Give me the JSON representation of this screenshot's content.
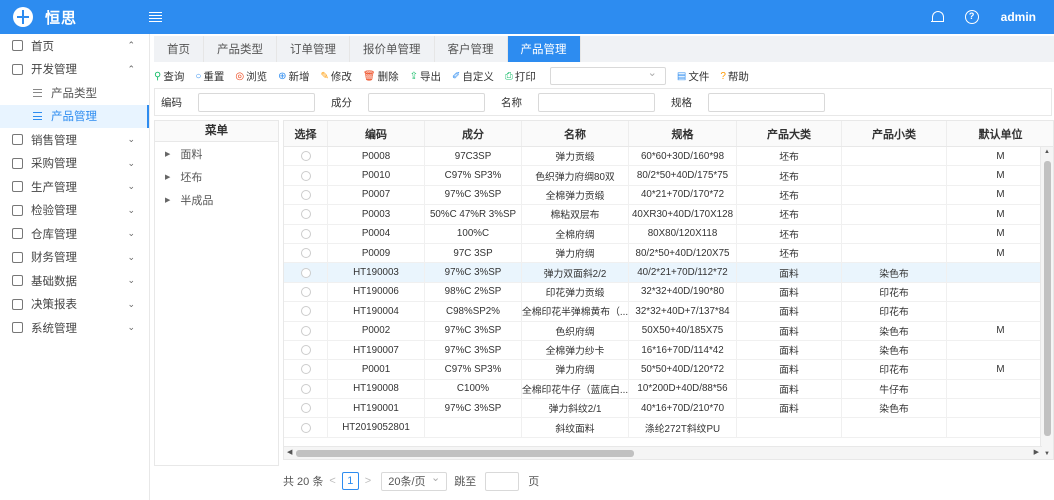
{
  "header": {
    "brand": "恒思",
    "username": "admin",
    "bg_color": "#2d8cf0"
  },
  "sidebar": {
    "items": [
      {
        "label": "首页",
        "icon": "home-icon",
        "arrow": "⌃"
      },
      {
        "label": "开发管理",
        "icon": "dev-icon",
        "arrow": "⌃",
        "children": [
          {
            "label": "产品类型",
            "active": false
          },
          {
            "label": "产品管理",
            "active": true
          }
        ]
      },
      {
        "label": "销售管理",
        "icon": "sales-icon",
        "arrow": "⌄"
      },
      {
        "label": "采购管理",
        "icon": "cart-icon",
        "arrow": "⌄"
      },
      {
        "label": "生产管理",
        "icon": "production-icon",
        "arrow": "⌄"
      },
      {
        "label": "检验管理",
        "icon": "inspection-icon",
        "arrow": "⌄"
      },
      {
        "label": "仓库管理",
        "icon": "warehouse-icon",
        "arrow": "⌄"
      },
      {
        "label": "财务管理",
        "icon": "finance-icon",
        "arrow": "⌄"
      },
      {
        "label": "基础数据",
        "icon": "chart-icon",
        "arrow": "⌄"
      },
      {
        "label": "决策报表",
        "icon": "report-icon",
        "arrow": "⌄"
      },
      {
        "label": "系统管理",
        "icon": "gear-icon",
        "arrow": "⌄"
      }
    ]
  },
  "tabs": [
    {
      "label": "首页",
      "active": false
    },
    {
      "label": "产品类型",
      "active": false
    },
    {
      "label": "订单管理",
      "active": false
    },
    {
      "label": "报价单管理",
      "active": false
    },
    {
      "label": "客户管理",
      "active": false
    },
    {
      "label": "产品管理",
      "active": true
    }
  ],
  "toolbar": {
    "buttons": [
      {
        "label": "查询",
        "icon": "search-icon",
        "glyph": "⚲",
        "color": "#19be6b"
      },
      {
        "label": "重置",
        "icon": "reset-icon",
        "glyph": "○",
        "color": "#2d8cf0"
      },
      {
        "label": "浏览",
        "icon": "eye-icon",
        "glyph": "◎",
        "color": "#ed4014"
      },
      {
        "label": "新增",
        "icon": "add-icon",
        "glyph": "⊕",
        "color": "#2d8cf0"
      },
      {
        "label": "修改",
        "icon": "edit-icon",
        "glyph": "✎",
        "color": "#ff9900"
      },
      {
        "label": "删除",
        "icon": "trash-icon",
        "glyph": "🗑",
        "color": "#ed4014"
      },
      {
        "label": "导出",
        "icon": "export-icon",
        "glyph": "⇪",
        "color": "#19be6b"
      },
      {
        "label": "自定义",
        "icon": "custom-icon",
        "glyph": "✐",
        "color": "#2d8cf0"
      },
      {
        "label": "打印",
        "icon": "print-icon",
        "glyph": "⎙",
        "color": "#19be6b"
      }
    ],
    "after_select": [
      {
        "label": "文件",
        "icon": "file-icon",
        "glyph": "▤",
        "color": "#2d8cf0"
      },
      {
        "label": "帮助",
        "icon": "help-icon",
        "glyph": "?",
        "color": "#ff9900"
      }
    ]
  },
  "search": {
    "fields": [
      {
        "label": "编码",
        "value": ""
      },
      {
        "label": "成分",
        "value": ""
      },
      {
        "label": "名称",
        "value": ""
      },
      {
        "label": "规格",
        "value": ""
      }
    ]
  },
  "tree": {
    "title": "菜单",
    "nodes": [
      "面料",
      "坯布",
      "半成品"
    ]
  },
  "grid": {
    "columns": [
      "选择",
      "编码",
      "成分",
      "名称",
      "规格",
      "产品大类",
      "产品小类",
      "默认单位"
    ],
    "rows": [
      [
        "P0008",
        "97C3SP",
        "弹力贡缎",
        "60*60+30D/160*98",
        "坯布",
        "",
        "M"
      ],
      [
        "P0010",
        "C97% SP3%",
        "色织弹力府绸80双",
        "80/2*50+40D/175*75",
        "坯布",
        "",
        "M"
      ],
      [
        "P0007",
        "97%C 3%SP",
        "全棉弹力贡缎",
        "40*21+70D/170*72",
        "坯布",
        "",
        "M"
      ],
      [
        "P0003",
        "50%C 47%R 3%SP",
        "棉粘双层布",
        "40XR30+40D/170X128",
        "坯布",
        "",
        "M"
      ],
      [
        "P0004",
        "100%C",
        "全棉府绸",
        "80X80/120X118",
        "坯布",
        "",
        "M"
      ],
      [
        "P0009",
        "97C 3SP",
        "弹力府绸",
        "80/2*50+40D/120X75",
        "坯布",
        "",
        "M"
      ],
      [
        "HT190003",
        "97%C 3%SP",
        "弹力双面斜2/2",
        "40/2*21+70D/112*72",
        "面料",
        "染色布",
        ""
      ],
      [
        "HT190006",
        "98%C 2%SP",
        "印花弹力贡缎",
        "32*32+40D/190*80",
        "面料",
        "印花布",
        ""
      ],
      [
        "HT190004",
        "C98%SP2%",
        "全棉印花半弹棉黄布（...",
        "32*32+40D+7/137*84",
        "面料",
        "印花布",
        ""
      ],
      [
        "P0002",
        "97%C 3%SP",
        "色织府绸",
        "50X50+40/185X75",
        "面料",
        "染色布",
        "M"
      ],
      [
        "HT190007",
        "97%C 3%SP",
        "全棉弹力纱卡",
        "16*16+70D/114*42",
        "面料",
        "染色布",
        ""
      ],
      [
        "P0001",
        "C97% SP3%",
        "弹力府绸",
        "50*50+40D/120*72",
        "面料",
        "印花布",
        "M"
      ],
      [
        "HT190008",
        "C100%",
        "全棉印花牛仔（蓝底白...",
        "10*200D+40D/88*56",
        "面料",
        "牛仔布",
        ""
      ],
      [
        "HT190001",
        "97%C 3%SP",
        "弹力斜纹2/1",
        "40*16+70D/210*70",
        "面料",
        "染色布",
        ""
      ],
      [
        "HT2019052801",
        "",
        "斜纹面料",
        "涤纶272T斜纹PU",
        "",
        "",
        ""
      ]
    ],
    "highlighted_row": 6
  },
  "pager": {
    "total": "共 20 条",
    "prev": "<",
    "current_page": "1",
    "next": ">",
    "page_size": "20条/页",
    "jump_label": "跳至",
    "page_suffix": "页"
  }
}
